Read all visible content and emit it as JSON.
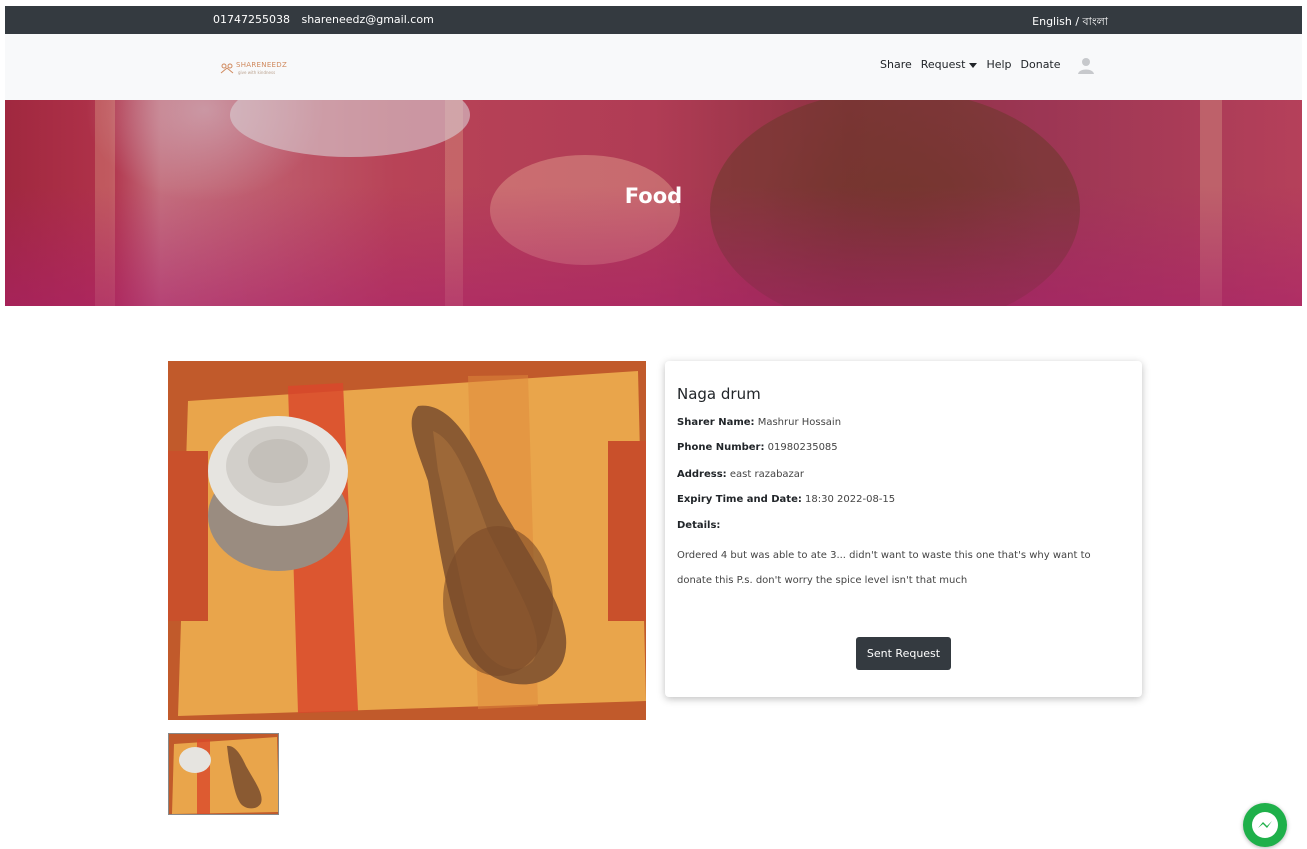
{
  "topbar": {
    "phone": "01747255038",
    "email": "shareneedz@gmail.com",
    "language": "English / বাংলা"
  },
  "nav": {
    "share": "Share",
    "request": "Request",
    "help": "Help",
    "donate": "Donate"
  },
  "hero": {
    "title": "Food"
  },
  "item": {
    "name": "Naga drum",
    "sharer_label": "Sharer Name:",
    "sharer_value": "Mashrur Hossain",
    "phone_label": "Phone Number:",
    "phone_value": "01980235085",
    "address_label": "Address:",
    "address_value": "east razabazar",
    "expiry_label": "Expiry Time and Date:",
    "expiry_value": "18:30 2022-08-15",
    "details_label": "Details:",
    "details_value": "Ordered 4 but was able to ate 3... didn't want to waste this one that's why want to donate this P.s. don't worry the spice level isn't that much",
    "request_button": "Sent Request"
  },
  "colors": {
    "topbar": "#343a40",
    "navbar": "#f8f9fa",
    "button": "#343a40",
    "messenger": "#1fb04a"
  },
  "icons": [
    "logo-mark-icon",
    "caret-down-icon",
    "user-icon",
    "messenger-icon"
  ]
}
